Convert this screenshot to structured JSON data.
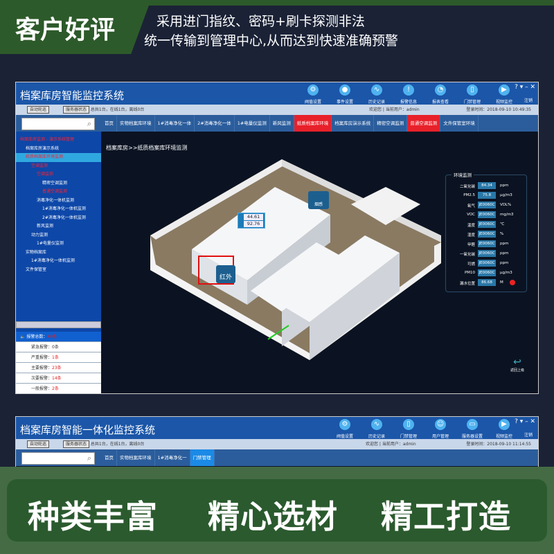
{
  "banner": {
    "badge": "客户好评",
    "line1": "采用进门指纹、密码+刷卡探测非法",
    "line2": "统一传输到管理中心,从而达到快速准确预警"
  },
  "window1": {
    "title": "档案库房智能监控系统",
    "tools": [
      {
        "icon": "gear-icon",
        "label": "阀值设置"
      },
      {
        "icon": "bell-icon",
        "label": "事件设置"
      },
      {
        "icon": "chart-icon",
        "label": "历史记录"
      },
      {
        "icon": "alert-icon",
        "label": "报警信息"
      },
      {
        "icon": "pie-icon",
        "label": "报表查看"
      },
      {
        "icon": "door-icon",
        "label": "门禁管理"
      },
      {
        "icon": "play-icon",
        "label": "视频监控"
      }
    ],
    "window_controls": "? ▾ – ✕",
    "logout": "注销",
    "status": {
      "btn1": "自动轮巡",
      "btn2": "服务器状态",
      "summary": "总共1台，在线1台，离线0台",
      "welcome": "欢迎您 | 当前用户：admin",
      "login_time": "登录时间：2018-09-10 10:49:35"
    },
    "tabs": [
      {
        "label": "首页",
        "state": ""
      },
      {
        "label": "实物档案库环境",
        "state": ""
      },
      {
        "label": "1#消毒净化一体",
        "state": ""
      },
      {
        "label": "2#消毒净化一体",
        "state": ""
      },
      {
        "label": "1#电量仪监测",
        "state": ""
      },
      {
        "label": "新风监测",
        "state": ""
      },
      {
        "label": "纸质档案库环境",
        "state": "red"
      },
      {
        "label": "档案库房演示系统",
        "state": ""
      },
      {
        "label": "精密空调监测",
        "state": ""
      },
      {
        "label": "普通空调监测",
        "state": "red"
      },
      {
        "label": "文件保管室环境",
        "state": ""
      }
    ],
    "tree": [
      {
        "label": "档案库房监测 - 演示系统管理",
        "cls": "red",
        "indent": 0
      },
      {
        "label": "档案库房演示系统",
        "cls": "",
        "indent": 1
      },
      {
        "label": "纸质档案库环境监测",
        "cls": "red sel",
        "indent": 1
      },
      {
        "label": "空调监测",
        "cls": "red",
        "indent": 2
      },
      {
        "label": "空调监测",
        "cls": "red",
        "indent": 3
      },
      {
        "label": "精密空调监测",
        "cls": "",
        "indent": 4
      },
      {
        "label": "普通空调监测",
        "cls": "red",
        "indent": 4
      },
      {
        "label": "消毒净化一体机监测",
        "cls": "",
        "indent": 3
      },
      {
        "label": "1#消毒净化一体机监测",
        "cls": "",
        "indent": 4
      },
      {
        "label": "2#消毒净化一体机监测",
        "cls": "",
        "indent": 4
      },
      {
        "label": "新风监测",
        "cls": "",
        "indent": 3
      },
      {
        "label": "动力监测",
        "cls": "",
        "indent": 2
      },
      {
        "label": "1#电量仪监测",
        "cls": "",
        "indent": 3
      },
      {
        "label": "实物档案库",
        "cls": "",
        "indent": 1
      },
      {
        "label": "1#消毒净化一体机监测",
        "cls": "",
        "indent": 2
      },
      {
        "label": "文件保管室",
        "cls": "",
        "indent": 1
      }
    ],
    "alarms": {
      "total_label": "报警总数：",
      "total": "40条",
      "items": [
        {
          "label": "紧急报警：",
          "value": "0条"
        },
        {
          "label": "严重报警：",
          "value": "1条"
        },
        {
          "label": "主要报警：",
          "value": "23条"
        },
        {
          "label": "次要报警：",
          "value": "14条"
        },
        {
          "label": "一般报警：",
          "value": "2条"
        }
      ]
    },
    "breadcrumb": "档案库房>>纸质档案库环境监测",
    "scene": {
      "temp": "44.61",
      "hum": "92.76",
      "unit": "%",
      "smoke_label": "烟感",
      "ir_label": "红外",
      "return_label": "返回上级"
    },
    "env": {
      "title": "环境监测",
      "rows": [
        {
          "label": "二氧化碳",
          "value": "84.34",
          "unit": "ppm"
        },
        {
          "label": "PM2.5",
          "value": "75.8",
          "unit": "μg/m3"
        },
        {
          "label": "氧气",
          "value": "JE0060C",
          "unit": "VOL%"
        },
        {
          "label": "VOC",
          "value": "JE0060C",
          "unit": "mg/m3"
        },
        {
          "label": "温度",
          "value": "JE0060C",
          "unit": "℃"
        },
        {
          "label": "湿度",
          "value": "JE0060C",
          "unit": "%"
        },
        {
          "label": "甲醛",
          "value": "JE0060C",
          "unit": "ppm"
        },
        {
          "label": "一氧化碳",
          "value": "JE0060C",
          "unit": "ppm"
        },
        {
          "label": "可燃",
          "value": "JE0060C",
          "unit": "ppm"
        },
        {
          "label": "PM10",
          "value": "JE0060C",
          "unit": "μg/m3"
        },
        {
          "label": "漏水位置",
          "value": "86.68",
          "unit": "M"
        }
      ]
    }
  },
  "window2": {
    "title": "档案库房智能一体化监控系统",
    "tools": [
      {
        "icon": "gear-icon",
        "label": "阀值设置"
      },
      {
        "icon": "chart-icon",
        "label": "历史记录"
      },
      {
        "icon": "door-icon",
        "label": "门禁管理"
      },
      {
        "icon": "user-icon",
        "label": "用户管理"
      },
      {
        "icon": "server-icon",
        "label": "服务器设置"
      },
      {
        "icon": "play-icon",
        "label": "视频监控"
      }
    ],
    "window_controls": "? ▾ – ✕",
    "logout": "注销",
    "status": {
      "btn1": "自动轮巡",
      "btn2": "服务器状态",
      "summary": "总共1台，在线1台，离线0台",
      "welcome": "欢迎您 | 当前用户：admin",
      "login_time": "登录时间：2018-09-10 11:14:55"
    },
    "tabs": [
      {
        "label": "首页",
        "state": ""
      },
      {
        "label": "实物档案库环境",
        "state": ""
      },
      {
        "label": "1#消毒净化一",
        "state": ""
      },
      {
        "label": "门禁管理",
        "state": "blue"
      }
    ]
  },
  "slogans": [
    "种类丰富",
    "精心选材",
    "精工打造"
  ],
  "colors": {
    "green": "#2d5a2a",
    "title_blue": "#1b56a8",
    "alert_red": "#e8202a"
  }
}
